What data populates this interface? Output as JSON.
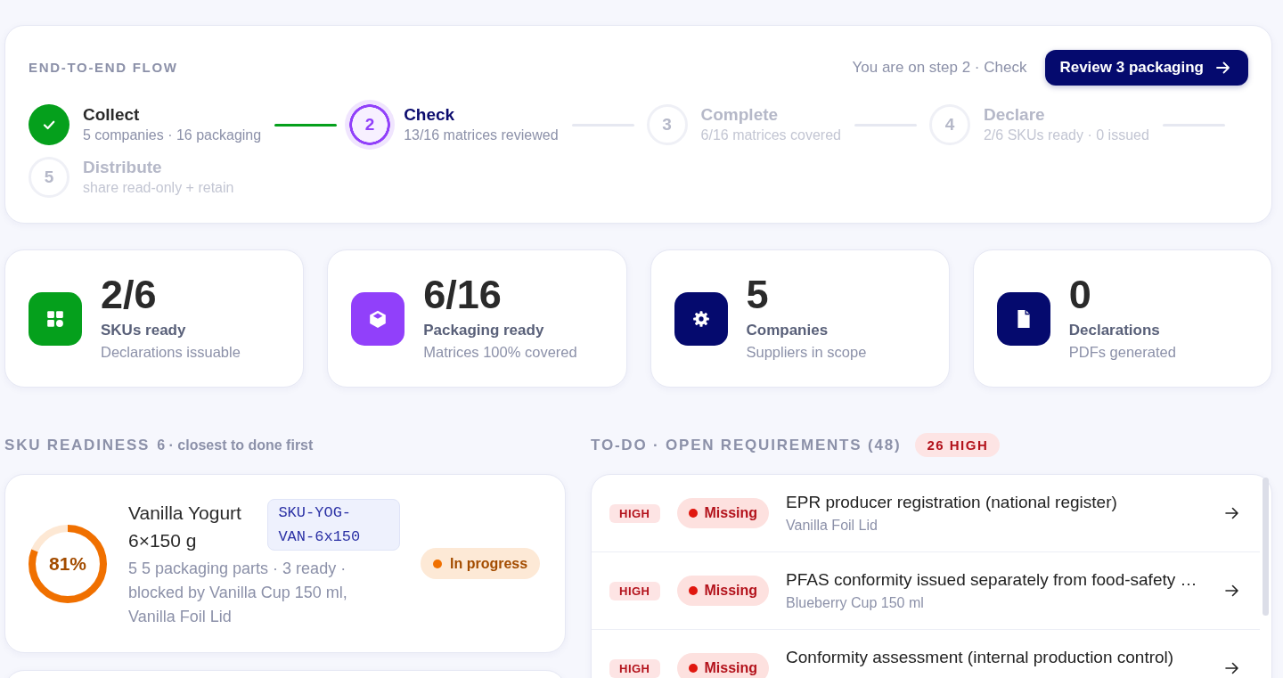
{
  "flow": {
    "title": "END-TO-END FLOW",
    "position_note": "You are on step 2 · Check",
    "action": "Review 3 packaging",
    "steps": [
      {
        "title": "Collect",
        "detail": "5 companies · 16 packaging",
        "done": true,
        "current": false
      },
      {
        "number": "2",
        "title": "Check",
        "detail": "13/16 matrices reviewed",
        "done": false,
        "current": true
      },
      {
        "number": "3",
        "title": "Complete",
        "detail": "6/16 matrices covered",
        "done": false,
        "current": false
      },
      {
        "number": "4",
        "title": "Declare",
        "detail": "2/6 SKUs ready · 0 issued",
        "done": false,
        "current": false
      },
      {
        "number": "5",
        "title": "Distribute",
        "detail": "share read-only + retain",
        "done": false,
        "current": false
      }
    ]
  },
  "stats": [
    {
      "kind": "grid",
      "color": "#05a01c",
      "value": "2/6",
      "label": "SKUs ready",
      "detail": "Declarations issuable"
    },
    {
      "kind": "box",
      "color": "#9140fa",
      "value": "6/16",
      "label": "Packaging ready",
      "detail": "Matrices 100% covered"
    },
    {
      "kind": "gear",
      "color": "#050a6e",
      "value": "5",
      "label": "Companies",
      "detail": "Suppliers in scope"
    },
    {
      "kind": "file",
      "color": "#050a6e",
      "value": "0",
      "label": "Declarations",
      "detail": "PDFs generated"
    }
  ],
  "sku_readiness": {
    "title": "SKU READINESS",
    "subtitle": "6 · closest to done first",
    "items": [
      {
        "name": "Vanilla Yogurt 6×150 g",
        "code": "SKU-YOG-VAN-6x150",
        "level": 0.81,
        "percent": "81%",
        "detail": "5 5 packaging parts · 3 ready · blocked by Vanilla Cup 150 ml, Vanilla Foil Lid",
        "kind": "in_progress",
        "status_label": "In progress"
      }
    ]
  },
  "todo": {
    "title": "TO-DO · OPEN REQUIREMENTS (48)",
    "badge": "26 HIGH",
    "items": [
      {
        "priority": {
          "label": "HIGH",
          "kind": "high"
        },
        "state": {
          "label": "Missing",
          "kind": "missing"
        },
        "title": "EPR producer registration (national register)",
        "subtitle": "Vanilla Foil Lid"
      },
      {
        "priority": {
          "label": "HIGH",
          "kind": "high"
        },
        "state": {
          "label": "Missing",
          "kind": "missing"
        },
        "title": "PFAS conformity issued separately from food-safety …",
        "subtitle": "Blueberry Cup 150 ml"
      },
      {
        "priority": {
          "label": "HIGH",
          "kind": "high"
        },
        "state": {
          "label": "Missing",
          "kind": "missing"
        },
        "title": "Conformity assessment (internal production control)"
      }
    ]
  }
}
